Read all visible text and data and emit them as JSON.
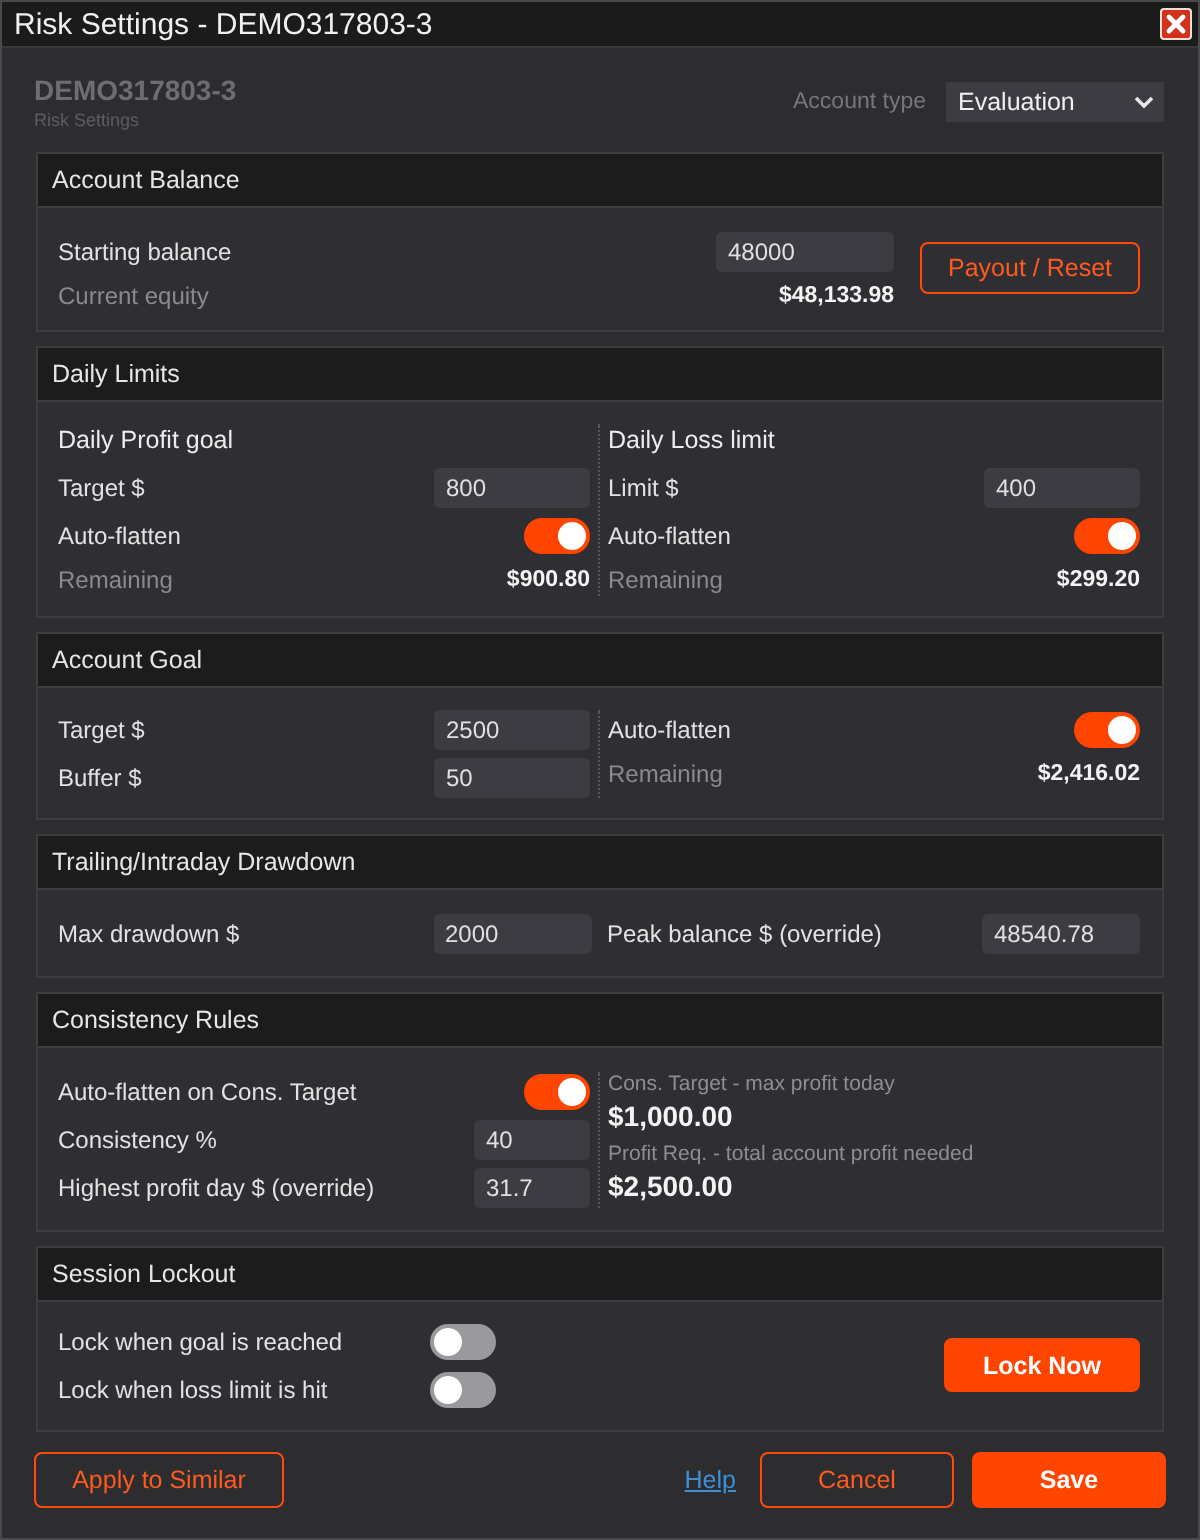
{
  "window": {
    "title": "Risk Settings - DEMO317803-3"
  },
  "header": {
    "account": "DEMO317803-3",
    "subtitle": "Risk Settings",
    "account_type": {
      "label": "Account type",
      "value": "Evaluation"
    }
  },
  "sections": [
    {
      "title": "Account Balance",
      "kind": "action",
      "columns": [
        {
          "rows": [
            {
              "kind": "input",
              "label": "Starting balance",
              "value": "48000"
            },
            {
              "kind": "readout",
              "label": "Current equity",
              "value": "$48,133.98"
            }
          ]
        }
      ],
      "button": {
        "label": "Payout / Reset",
        "kind": "outline"
      }
    },
    {
      "title": "Daily Limits",
      "kind": "split",
      "columns": [
        {
          "rows": [
            {
              "kind": "heading",
              "label": "Daily Profit goal"
            },
            {
              "kind": "input",
              "label": "Target $",
              "value": "800"
            },
            {
              "kind": "toggle",
              "label": "Auto-flatten",
              "on": true
            },
            {
              "kind": "readout",
              "label": "Remaining",
              "value": "$900.80"
            }
          ]
        },
        {
          "rows": [
            {
              "kind": "heading",
              "label": "Daily Loss limit"
            },
            {
              "kind": "input",
              "label": "Limit $",
              "value": "400"
            },
            {
              "kind": "toggle",
              "label": "Auto-flatten",
              "on": true
            },
            {
              "kind": "readout",
              "label": "Remaining",
              "value": "$299.20"
            }
          ]
        }
      ]
    },
    {
      "title": "Account Goal",
      "kind": "split",
      "columns": [
        {
          "rows": [
            {
              "kind": "input",
              "label": "Target $",
              "value": "2500"
            },
            {
              "kind": "input",
              "label": "Buffer $",
              "value": "50"
            }
          ]
        },
        {
          "rows": [
            {
              "kind": "toggle",
              "label": "Auto-flatten",
              "on": true
            },
            {
              "kind": "readout",
              "label": "Remaining",
              "value": "$2,416.02"
            }
          ]
        }
      ]
    },
    {
      "title": "Trailing/Intraday Drawdown",
      "kind": "pair",
      "columns": [
        {
          "rows": [
            {
              "kind": "input",
              "label": "Max drawdown $",
              "value": "2000"
            }
          ]
        },
        {
          "rows": [
            {
              "kind": "input",
              "label": "Peak balance $ (override)",
              "value": "48540.78"
            }
          ]
        }
      ]
    },
    {
      "title": "Consistency Rules",
      "kind": "stats",
      "columns": [
        {
          "rows": [
            {
              "kind": "toggle",
              "label": "Auto-flatten on Cons. Target",
              "on": true
            },
            {
              "kind": "input",
              "label": "Consistency %",
              "value": "40"
            },
            {
              "kind": "input",
              "label": "Highest profit day $ (override)",
              "value": "31.7"
            }
          ]
        },
        {
          "rows": [
            {
              "kind": "stat",
              "label": "Cons. Target - max profit today",
              "value": "$1,000.00"
            },
            {
              "kind": "stat",
              "label": "Profit Req. - total account profit needed",
              "value": "$2,500.00"
            }
          ]
        }
      ]
    },
    {
      "title": "Session Lockout",
      "kind": "lockout",
      "columns": [
        {
          "rows": [
            {
              "kind": "toggle",
              "label": "Lock when goal is reached",
              "on": false
            },
            {
              "kind": "toggle",
              "label": "Lock when loss limit is hit",
              "on": false
            }
          ]
        }
      ],
      "button": {
        "label": "Lock Now",
        "kind": "primary"
      }
    }
  ],
  "footer": {
    "buttons": [
      {
        "label": "Apply to Similar",
        "kind": "outline"
      },
      {
        "label": "Help",
        "kind": "link"
      },
      {
        "label": "Cancel",
        "kind": "outline"
      },
      {
        "label": "Save",
        "kind": "primary"
      }
    ]
  }
}
